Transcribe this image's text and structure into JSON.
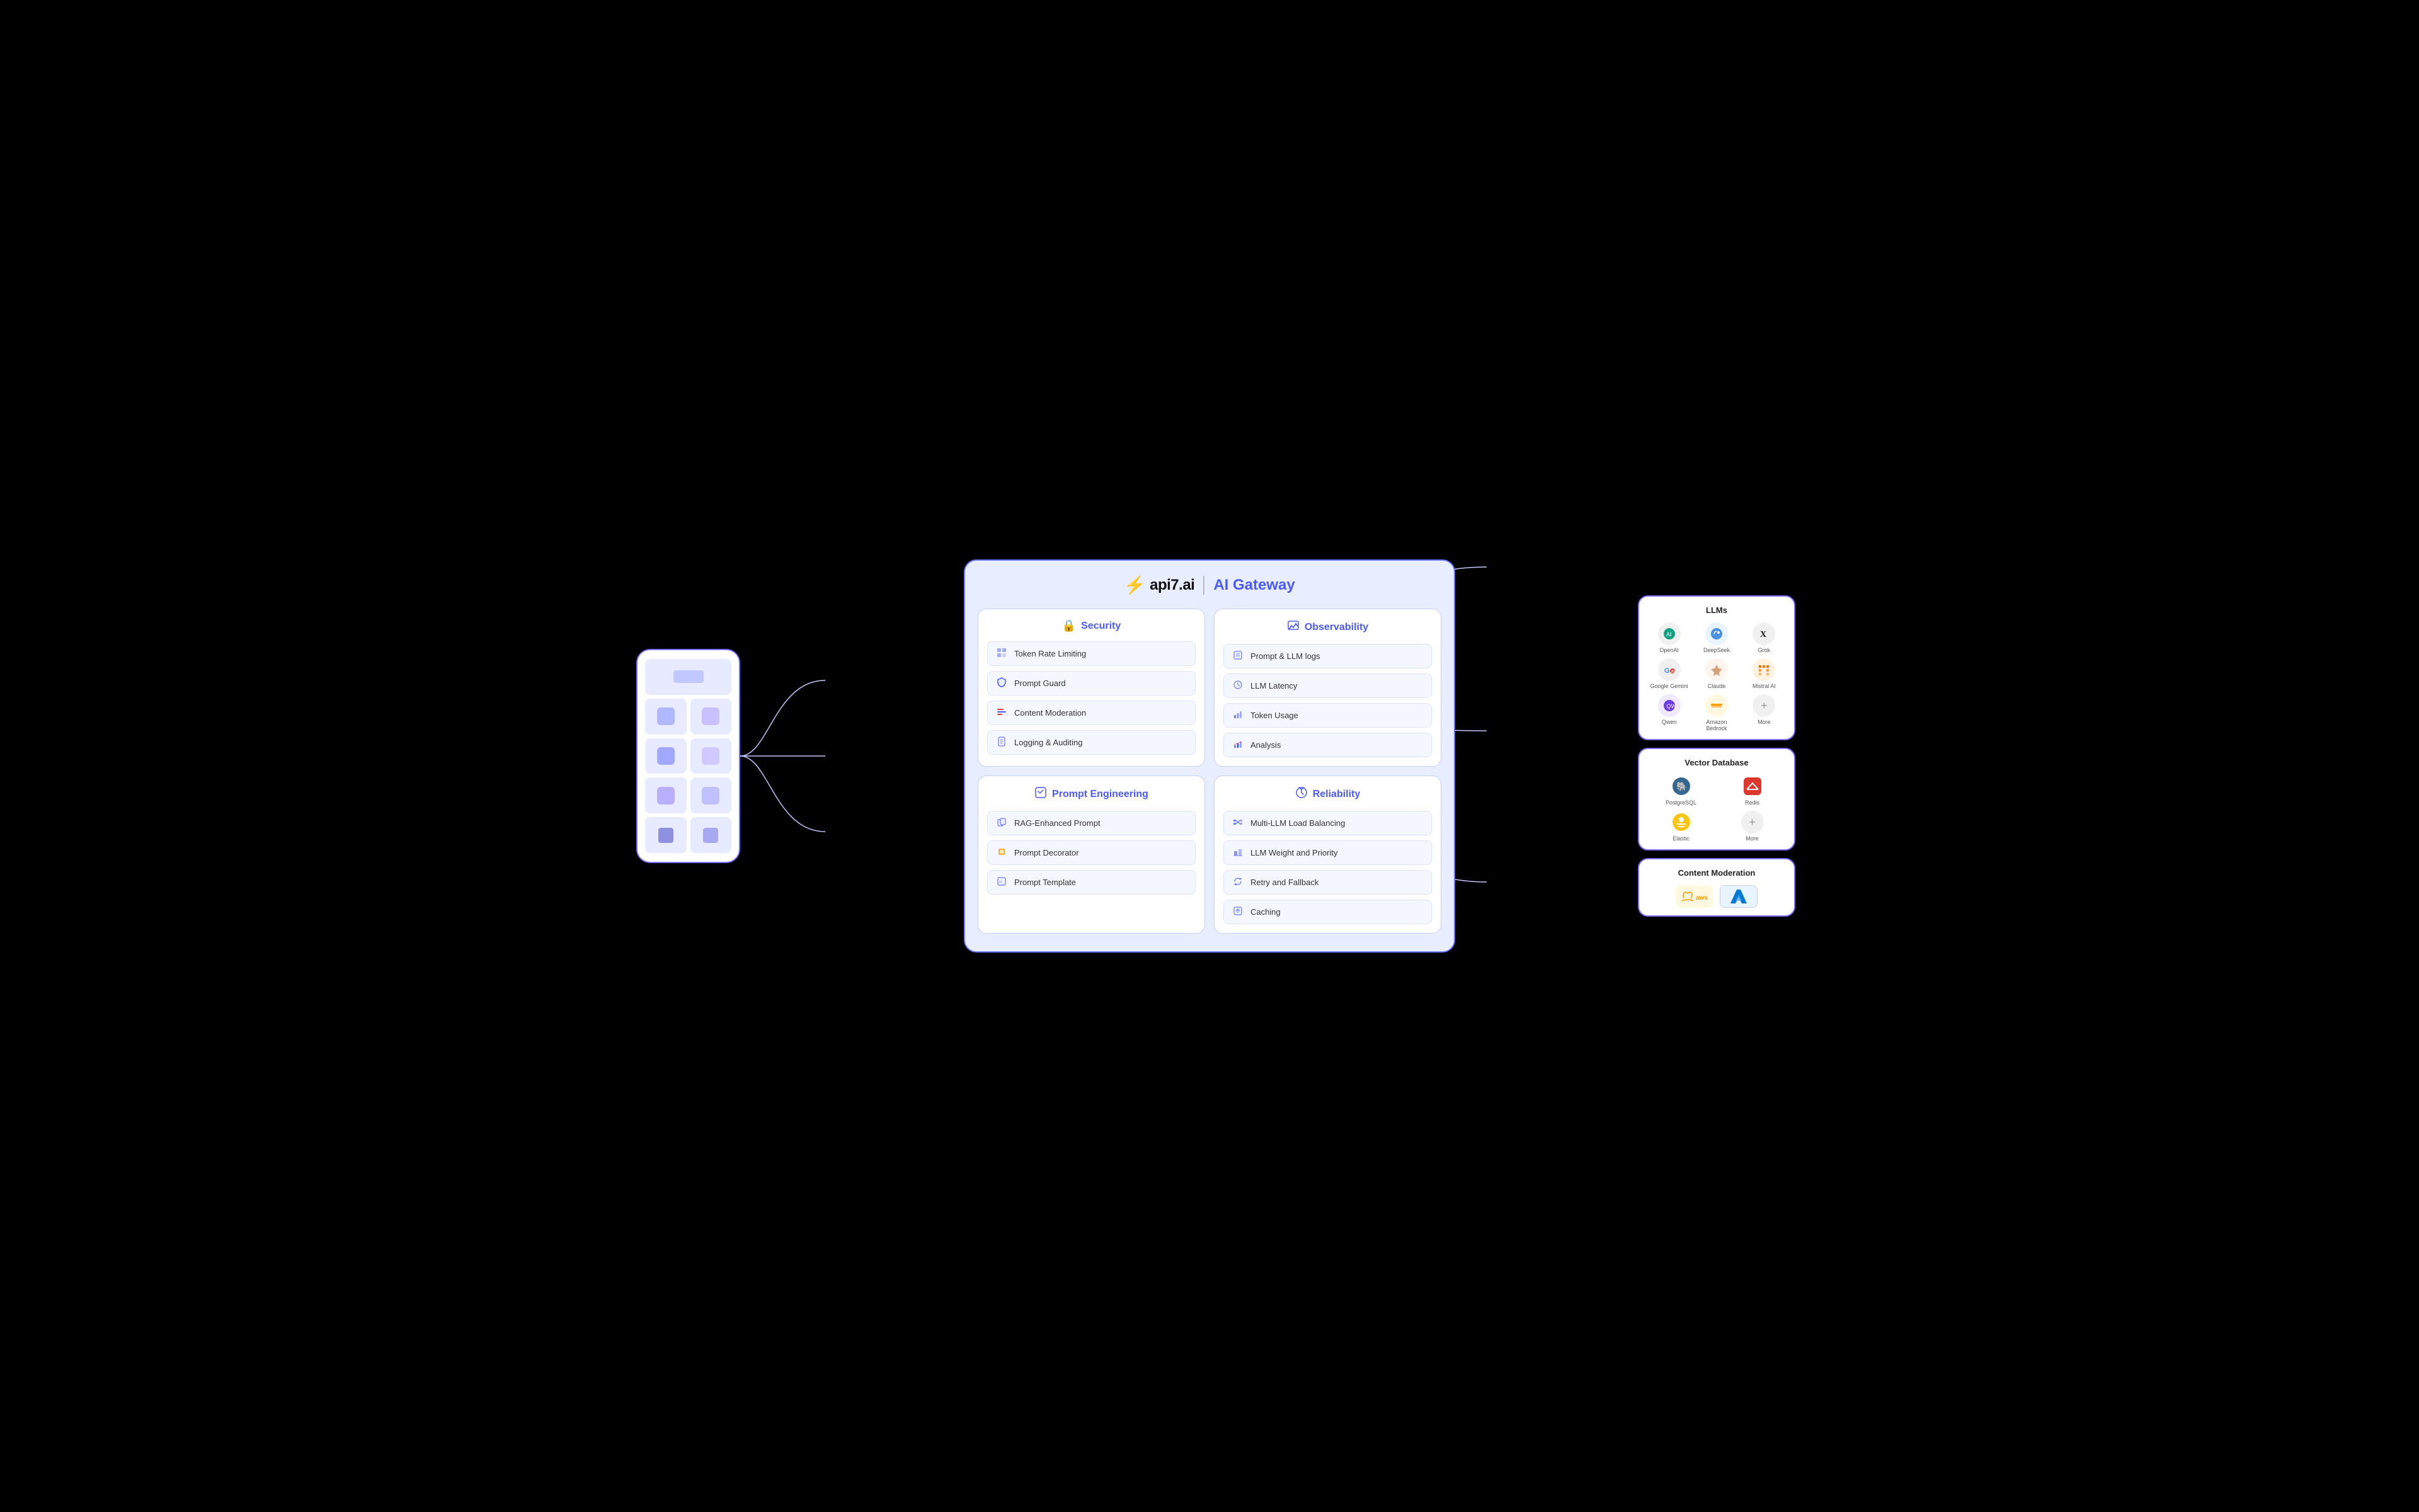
{
  "header": {
    "logo_bolt": "⚡",
    "logo_text": "api7.ai",
    "divider": "|",
    "title": "AI Gateway"
  },
  "sections": {
    "security": {
      "icon": "🔒",
      "title": "Security",
      "items": [
        {
          "icon": "⊞",
          "label": "Token Rate Limiting"
        },
        {
          "icon": "🛡",
          "label": "Prompt Guard"
        },
        {
          "icon": "⊘",
          "label": "Content Moderation"
        },
        {
          "icon": "📋",
          "label": "Logging & Auditing"
        }
      ]
    },
    "observability": {
      "icon": "📊",
      "title": "Observability",
      "items": [
        {
          "icon": "📄",
          "label": "Prompt & LLM logs"
        },
        {
          "icon": "⏱",
          "label": "LLM Latency"
        },
        {
          "icon": "📈",
          "label": "Token Usage"
        },
        {
          "icon": "📉",
          "label": "Analysis"
        }
      ]
    },
    "prompt_engineering": {
      "icon": "⚙",
      "title": "Prompt Engineering",
      "items": [
        {
          "icon": "📎",
          "label": "RAG-Enhanced Prompt"
        },
        {
          "icon": "🔸",
          "label": "Prompt Decorator"
        },
        {
          "icon": "▶",
          "label": "Prompt Template"
        }
      ]
    },
    "reliability": {
      "icon": "⚡",
      "title": "Reliability",
      "items": [
        {
          "icon": "⊞",
          "label": "Multi-LLM Load Balancing"
        },
        {
          "icon": "⊟",
          "label": "LLM Weight and Priority"
        },
        {
          "icon": "↺",
          "label": "Retry and Fallback"
        },
        {
          "icon": "💾",
          "label": "Caching"
        }
      ]
    }
  },
  "right_panels": {
    "llms": {
      "title": "LLMs",
      "items": [
        {
          "label": "OpenAI",
          "emoji": "⊙",
          "color": "#10a37f"
        },
        {
          "label": "DeepSeek",
          "emoji": "🐳",
          "color": "#4a90e2"
        },
        {
          "label": "Grok",
          "emoji": "✕",
          "color": "#111"
        },
        {
          "label": "Google Gemini",
          "emoji": "◈",
          "color": "#4285f4"
        },
        {
          "label": "Claude",
          "emoji": "✦",
          "color": "#d4a27a"
        },
        {
          "label": "Mistral AI",
          "emoji": "▦",
          "color": "#ff7000"
        },
        {
          "label": "Qwen",
          "emoji": "◉",
          "color": "#6a3de8"
        },
        {
          "label": "Amazon Bedrock",
          "emoji": "☁",
          "color": "#ff9900"
        },
        {
          "label": "More",
          "emoji": "+",
          "color": "#aaa"
        }
      ]
    },
    "vector_database": {
      "title": "Vector Database",
      "items": [
        {
          "label": "PostgreSQL",
          "emoji": "🐘",
          "color": "#336791"
        },
        {
          "label": "Redis",
          "emoji": "⬡",
          "color": "#dc382d"
        },
        {
          "label": "Elastic",
          "emoji": "🔍",
          "color": "#fec514"
        },
        {
          "label": "More",
          "emoji": "+",
          "color": "#aaa"
        }
      ]
    },
    "content_moderation": {
      "title": "Content Moderation",
      "items": [
        {
          "label": "AWS",
          "type": "aws"
        },
        {
          "label": "Azure",
          "type": "azure"
        }
      ]
    }
  }
}
